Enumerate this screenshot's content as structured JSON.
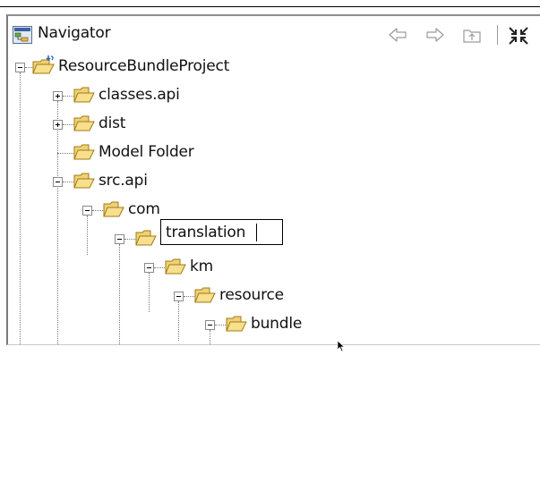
{
  "view": {
    "title": "Navigator",
    "toolbar": {
      "back": "back-icon",
      "forward": "forward-icon",
      "up": "up-icon",
      "collapse_all": "collapse-all-icon"
    }
  },
  "tree": {
    "root": {
      "label": "ResourceBundleProject",
      "expanded": true
    },
    "items": [
      {
        "label": "classes.api",
        "expanded": false
      },
      {
        "label": "dist",
        "expanded": false
      },
      {
        "label": "Model Folder",
        "expanded": null
      },
      {
        "label": "src.api",
        "expanded": true
      },
      {
        "label": "com",
        "expanded": true
      },
      {
        "label": "translation",
        "expanded": true,
        "editing": true
      },
      {
        "label": "km",
        "expanded": true
      },
      {
        "label": "resource",
        "expanded": true
      },
      {
        "label": "bundle",
        "expanded": true
      }
    ]
  },
  "rename": {
    "value": "translation"
  },
  "colors": {
    "folder_fill": "#f0d078",
    "folder_edge": "#a07b10",
    "tree_lines": "#7a7a7a"
  }
}
